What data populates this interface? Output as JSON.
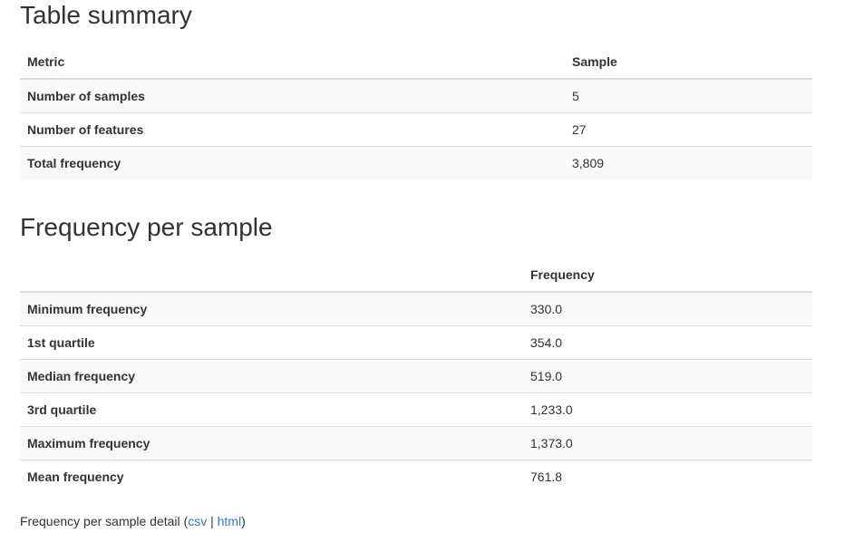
{
  "summary": {
    "title": "Table summary",
    "headers": {
      "metric": "Metric",
      "sample": "Sample"
    },
    "rows": [
      {
        "label": "Number of samples",
        "value": "5"
      },
      {
        "label": "Number of features",
        "value": "27"
      },
      {
        "label": "Total frequency",
        "value": "3,809"
      }
    ]
  },
  "frequency": {
    "title": "Frequency per sample",
    "headers": {
      "blank": "",
      "frequency": "Frequency"
    },
    "rows": [
      {
        "label": "Minimum frequency",
        "value": "330.0"
      },
      {
        "label": "1st quartile",
        "value": "354.0"
      },
      {
        "label": "Median frequency",
        "value": "519.0"
      },
      {
        "label": "3rd quartile",
        "value": "1,233.0"
      },
      {
        "label": "Maximum frequency",
        "value": "1,373.0"
      },
      {
        "label": "Mean frequency",
        "value": "761.8"
      }
    ]
  },
  "detail": {
    "text": "Frequency per sample detail (",
    "csv_label": "csv",
    "separator": " | ",
    "html_label": "html",
    "close": ")"
  }
}
